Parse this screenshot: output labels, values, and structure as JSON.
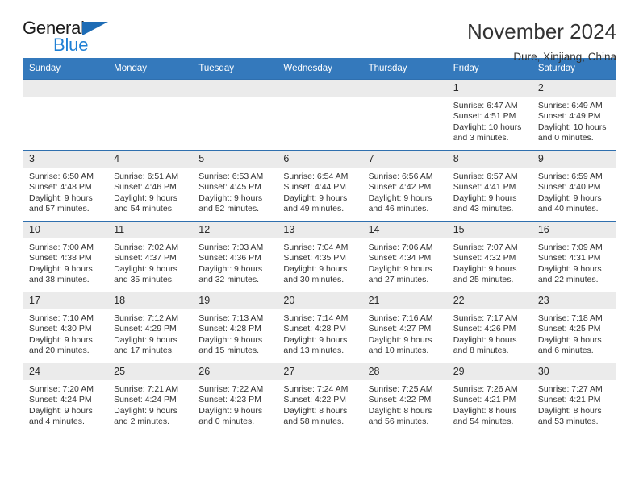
{
  "logo": {
    "word_top": "General",
    "word_bottom": "Blue",
    "triangle_color": "#1e6cb5",
    "blue_color": "#1e7fd4"
  },
  "header": {
    "title": "November 2024",
    "location": "Dure, Xinjiang, China"
  },
  "theme": {
    "header_blue": "#3479bc",
    "row_rule_blue": "#2f6fae",
    "daynum_band": "#ebebeb"
  },
  "weekdays": [
    "Sunday",
    "Monday",
    "Tuesday",
    "Wednesday",
    "Thursday",
    "Friday",
    "Saturday"
  ],
  "weeks": [
    [
      {
        "day": "",
        "sunrise": "",
        "sunset": "",
        "daylight1": "",
        "daylight2": ""
      },
      {
        "day": "",
        "sunrise": "",
        "sunset": "",
        "daylight1": "",
        "daylight2": ""
      },
      {
        "day": "",
        "sunrise": "",
        "sunset": "",
        "daylight1": "",
        "daylight2": ""
      },
      {
        "day": "",
        "sunrise": "",
        "sunset": "",
        "daylight1": "",
        "daylight2": ""
      },
      {
        "day": "",
        "sunrise": "",
        "sunset": "",
        "daylight1": "",
        "daylight2": ""
      },
      {
        "day": "1",
        "sunrise": "Sunrise: 6:47 AM",
        "sunset": "Sunset: 4:51 PM",
        "daylight1": "Daylight: 10 hours",
        "daylight2": "and 3 minutes."
      },
      {
        "day": "2",
        "sunrise": "Sunrise: 6:49 AM",
        "sunset": "Sunset: 4:49 PM",
        "daylight1": "Daylight: 10 hours",
        "daylight2": "and 0 minutes."
      }
    ],
    [
      {
        "day": "3",
        "sunrise": "Sunrise: 6:50 AM",
        "sunset": "Sunset: 4:48 PM",
        "daylight1": "Daylight: 9 hours",
        "daylight2": "and 57 minutes."
      },
      {
        "day": "4",
        "sunrise": "Sunrise: 6:51 AM",
        "sunset": "Sunset: 4:46 PM",
        "daylight1": "Daylight: 9 hours",
        "daylight2": "and 54 minutes."
      },
      {
        "day": "5",
        "sunrise": "Sunrise: 6:53 AM",
        "sunset": "Sunset: 4:45 PM",
        "daylight1": "Daylight: 9 hours",
        "daylight2": "and 52 minutes."
      },
      {
        "day": "6",
        "sunrise": "Sunrise: 6:54 AM",
        "sunset": "Sunset: 4:44 PM",
        "daylight1": "Daylight: 9 hours",
        "daylight2": "and 49 minutes."
      },
      {
        "day": "7",
        "sunrise": "Sunrise: 6:56 AM",
        "sunset": "Sunset: 4:42 PM",
        "daylight1": "Daylight: 9 hours",
        "daylight2": "and 46 minutes."
      },
      {
        "day": "8",
        "sunrise": "Sunrise: 6:57 AM",
        "sunset": "Sunset: 4:41 PM",
        "daylight1": "Daylight: 9 hours",
        "daylight2": "and 43 minutes."
      },
      {
        "day": "9",
        "sunrise": "Sunrise: 6:59 AM",
        "sunset": "Sunset: 4:40 PM",
        "daylight1": "Daylight: 9 hours",
        "daylight2": "and 40 minutes."
      }
    ],
    [
      {
        "day": "10",
        "sunrise": "Sunrise: 7:00 AM",
        "sunset": "Sunset: 4:38 PM",
        "daylight1": "Daylight: 9 hours",
        "daylight2": "and 38 minutes."
      },
      {
        "day": "11",
        "sunrise": "Sunrise: 7:02 AM",
        "sunset": "Sunset: 4:37 PM",
        "daylight1": "Daylight: 9 hours",
        "daylight2": "and 35 minutes."
      },
      {
        "day": "12",
        "sunrise": "Sunrise: 7:03 AM",
        "sunset": "Sunset: 4:36 PM",
        "daylight1": "Daylight: 9 hours",
        "daylight2": "and 32 minutes."
      },
      {
        "day": "13",
        "sunrise": "Sunrise: 7:04 AM",
        "sunset": "Sunset: 4:35 PM",
        "daylight1": "Daylight: 9 hours",
        "daylight2": "and 30 minutes."
      },
      {
        "day": "14",
        "sunrise": "Sunrise: 7:06 AM",
        "sunset": "Sunset: 4:34 PM",
        "daylight1": "Daylight: 9 hours",
        "daylight2": "and 27 minutes."
      },
      {
        "day": "15",
        "sunrise": "Sunrise: 7:07 AM",
        "sunset": "Sunset: 4:32 PM",
        "daylight1": "Daylight: 9 hours",
        "daylight2": "and 25 minutes."
      },
      {
        "day": "16",
        "sunrise": "Sunrise: 7:09 AM",
        "sunset": "Sunset: 4:31 PM",
        "daylight1": "Daylight: 9 hours",
        "daylight2": "and 22 minutes."
      }
    ],
    [
      {
        "day": "17",
        "sunrise": "Sunrise: 7:10 AM",
        "sunset": "Sunset: 4:30 PM",
        "daylight1": "Daylight: 9 hours",
        "daylight2": "and 20 minutes."
      },
      {
        "day": "18",
        "sunrise": "Sunrise: 7:12 AM",
        "sunset": "Sunset: 4:29 PM",
        "daylight1": "Daylight: 9 hours",
        "daylight2": "and 17 minutes."
      },
      {
        "day": "19",
        "sunrise": "Sunrise: 7:13 AM",
        "sunset": "Sunset: 4:28 PM",
        "daylight1": "Daylight: 9 hours",
        "daylight2": "and 15 minutes."
      },
      {
        "day": "20",
        "sunrise": "Sunrise: 7:14 AM",
        "sunset": "Sunset: 4:28 PM",
        "daylight1": "Daylight: 9 hours",
        "daylight2": "and 13 minutes."
      },
      {
        "day": "21",
        "sunrise": "Sunrise: 7:16 AM",
        "sunset": "Sunset: 4:27 PM",
        "daylight1": "Daylight: 9 hours",
        "daylight2": "and 10 minutes."
      },
      {
        "day": "22",
        "sunrise": "Sunrise: 7:17 AM",
        "sunset": "Sunset: 4:26 PM",
        "daylight1": "Daylight: 9 hours",
        "daylight2": "and 8 minutes."
      },
      {
        "day": "23",
        "sunrise": "Sunrise: 7:18 AM",
        "sunset": "Sunset: 4:25 PM",
        "daylight1": "Daylight: 9 hours",
        "daylight2": "and 6 minutes."
      }
    ],
    [
      {
        "day": "24",
        "sunrise": "Sunrise: 7:20 AM",
        "sunset": "Sunset: 4:24 PM",
        "daylight1": "Daylight: 9 hours",
        "daylight2": "and 4 minutes."
      },
      {
        "day": "25",
        "sunrise": "Sunrise: 7:21 AM",
        "sunset": "Sunset: 4:24 PM",
        "daylight1": "Daylight: 9 hours",
        "daylight2": "and 2 minutes."
      },
      {
        "day": "26",
        "sunrise": "Sunrise: 7:22 AM",
        "sunset": "Sunset: 4:23 PM",
        "daylight1": "Daylight: 9 hours",
        "daylight2": "and 0 minutes."
      },
      {
        "day": "27",
        "sunrise": "Sunrise: 7:24 AM",
        "sunset": "Sunset: 4:22 PM",
        "daylight1": "Daylight: 8 hours",
        "daylight2": "and 58 minutes."
      },
      {
        "day": "28",
        "sunrise": "Sunrise: 7:25 AM",
        "sunset": "Sunset: 4:22 PM",
        "daylight1": "Daylight: 8 hours",
        "daylight2": "and 56 minutes."
      },
      {
        "day": "29",
        "sunrise": "Sunrise: 7:26 AM",
        "sunset": "Sunset: 4:21 PM",
        "daylight1": "Daylight: 8 hours",
        "daylight2": "and 54 minutes."
      },
      {
        "day": "30",
        "sunrise": "Sunrise: 7:27 AM",
        "sunset": "Sunset: 4:21 PM",
        "daylight1": "Daylight: 8 hours",
        "daylight2": "and 53 minutes."
      }
    ]
  ]
}
